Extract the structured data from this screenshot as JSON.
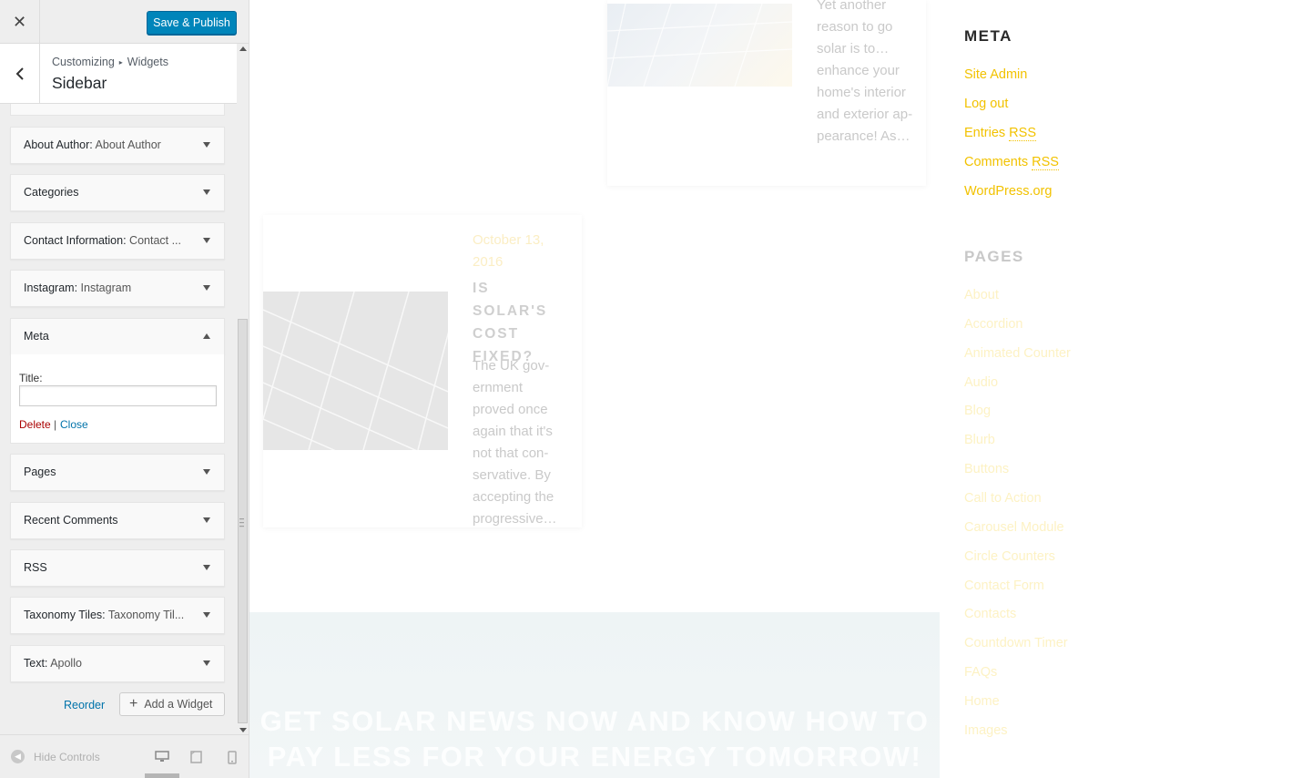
{
  "panel": {
    "close_label": "✕",
    "save_label": "Save & Publish",
    "breadcrumb_root": "Customizing",
    "breadcrumb_sep": "▸",
    "breadcrumb_leaf": "Widgets",
    "section_title": "Sidebar"
  },
  "widgets": [
    {
      "name": "About Author:",
      "subtitle": " About Author",
      "expanded": false
    },
    {
      "name": "Categories",
      "subtitle": "",
      "expanded": false
    },
    {
      "name": "Contact Information:",
      "subtitle": " Contact ...",
      "expanded": false
    },
    {
      "name": "Instagram:",
      "subtitle": " Instagram",
      "expanded": false
    },
    {
      "name": "Meta",
      "subtitle": "",
      "expanded": true
    },
    {
      "name": "Pages",
      "subtitle": "",
      "expanded": false
    },
    {
      "name": "Recent Comments",
      "subtitle": "",
      "expanded": false
    },
    {
      "name": "RSS",
      "subtitle": "",
      "expanded": false
    },
    {
      "name": "Taxonomy Tiles:",
      "subtitle": " Taxonomy Til...",
      "expanded": false
    },
    {
      "name": "Text:",
      "subtitle": " Apollo",
      "expanded": false
    }
  ],
  "meta_form": {
    "title_label": "Title:",
    "title_value": "",
    "delete_label": "Delete",
    "separator": "|",
    "close_label": "Close"
  },
  "actions": {
    "reorder_label": "Reorder",
    "add_widget_label": "Add a Widget"
  },
  "footer": {
    "hide_controls_label": "Hide Controls"
  },
  "preview": {
    "post1_excerpt": "Yet another reason to go solar is to…enhance your home's interior and exterior ap-pearance! As…",
    "post2_date": "October 13, 2016",
    "post2_title": "IS SOLAR'S COST FIXED?",
    "post2_excerpt": "The UK gov-ernment proved once again that it's not that con-servative. By accepting the progressive…",
    "banner_text": "GET SOLAR NEWS NOW AND KNOW HOW TO PAY LESS FOR YOUR ENERGY TOMORROW!",
    "meta_heading": "META",
    "meta_links": [
      {
        "text": "Site Admin",
        "abbr": ""
      },
      {
        "text": "Log out",
        "abbr": ""
      },
      {
        "text": "Entries ",
        "abbr": "RSS"
      },
      {
        "text": "Comments ",
        "abbr": "RSS"
      },
      {
        "text": "WordPress.org",
        "abbr": ""
      }
    ],
    "pages_heading": "PAGES",
    "pages_links": [
      "About",
      "Accordion",
      "Animated Counter",
      "Audio",
      "Blog",
      "Blurb",
      "Buttons",
      "Call to Action",
      "Carousel Module",
      "Circle Counters",
      "Contact Form",
      "Contacts",
      "Countdown Timer",
      "FAQs",
      "Home",
      "Images"
    ]
  },
  "colors": {
    "accent": "#0085ba",
    "link": "#0073aa",
    "delete": "#aa0000",
    "meta_link": "#f2c200"
  }
}
